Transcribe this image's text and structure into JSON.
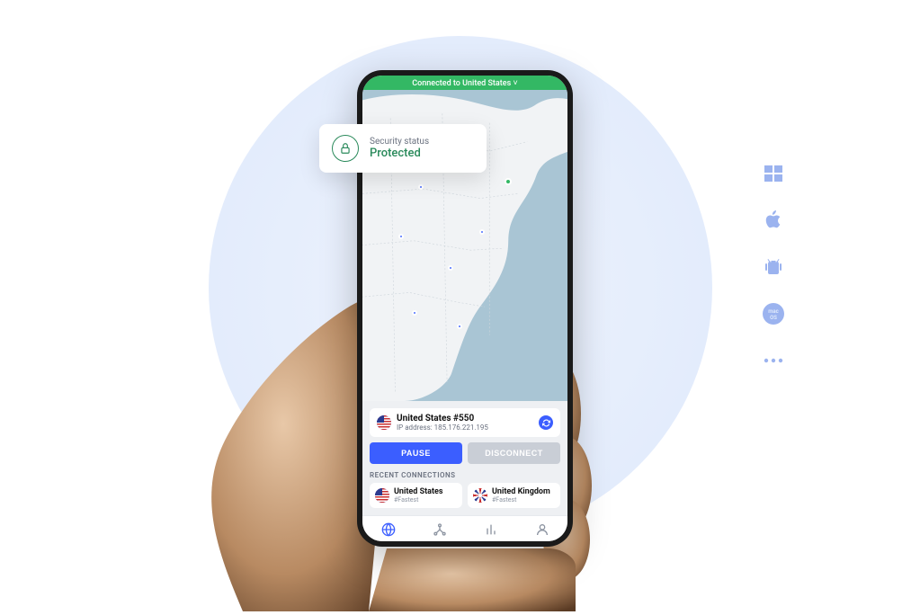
{
  "connection_banner": "Connected to United States ˅",
  "security_card": {
    "label": "Security status",
    "value": "Protected"
  },
  "server": {
    "name": "United States #550",
    "ip_label": "IP address: 185.176.221.195"
  },
  "buttons": {
    "pause": "PAUSE",
    "disconnect": "DISCONNECT"
  },
  "recent": {
    "heading": "RECENT CONNECTIONS",
    "items": [
      {
        "name": "United States",
        "sub": "#Fastest"
      },
      {
        "name": "United Kingdom",
        "sub": "#Fastest"
      }
    ]
  },
  "platform_icons": [
    "windows",
    "apple",
    "android",
    "macos",
    "more"
  ]
}
